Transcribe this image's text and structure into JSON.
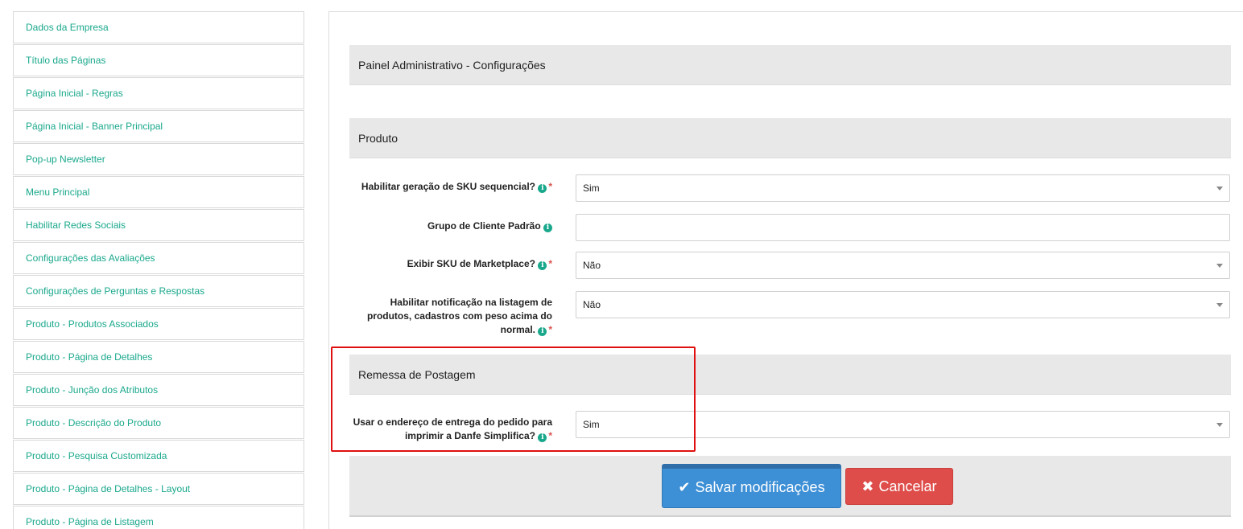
{
  "sidebar": {
    "items": [
      {
        "label": "Dados da Empresa"
      },
      {
        "label": "Título das Páginas"
      },
      {
        "label": "Página Inicial - Regras"
      },
      {
        "label": "Página Inicial - Banner Principal"
      },
      {
        "label": "Pop-up Newsletter"
      },
      {
        "label": "Menu Principal"
      },
      {
        "label": "Habilitar Redes Sociais"
      },
      {
        "label": "Configurações das Avaliações"
      },
      {
        "label": "Configurações de Perguntas e Respostas"
      },
      {
        "label": "Produto - Produtos Associados"
      },
      {
        "label": "Produto - Página de Detalhes"
      },
      {
        "label": "Produto - Junção dos Atributos"
      },
      {
        "label": "Produto - Descrição do Produto"
      },
      {
        "label": "Produto - Pesquisa Customizada"
      },
      {
        "label": "Produto - Página de Detalhes - Layout"
      },
      {
        "label": "Produto - Página de Listagem"
      }
    ]
  },
  "main": {
    "page_title": "Painel Administrativo - Configurações",
    "sections": {
      "produto": {
        "title": "Produto",
        "fields": [
          {
            "label": "Habilitar geração de SKU sequencial?",
            "required": "*",
            "value": "Sim"
          },
          {
            "label": "Grupo de Cliente Padrão",
            "required": "",
            "value": ""
          },
          {
            "label": "Exibir SKU de Marketplace?",
            "required": "*",
            "value": "Não"
          },
          {
            "label": "Habilitar notificação na listagem de produtos, cadastros com peso acima do normal.",
            "required": "*",
            "value": "Não"
          }
        ]
      },
      "remessa": {
        "title": "Remessa de Postagem",
        "fields": [
          {
            "label": "Usar o endereço de entrega do pedido para imprimir a Danfe Simplifica?",
            "required": "*",
            "value": "Sim"
          }
        ]
      }
    },
    "info_glyph": "i",
    "buttons": {
      "save_icon": "✔",
      "save_label": "Salvar modificações",
      "cancel_icon": "✖",
      "cancel_label": "Cancelar"
    }
  },
  "colors": {
    "link": "#1aa88c",
    "save": "#3d8fd6",
    "cancel": "#de4d4a",
    "highlight": "#e01010"
  }
}
